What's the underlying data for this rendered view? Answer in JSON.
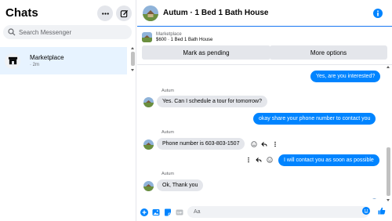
{
  "sidebar": {
    "title": "Chats",
    "more_icon": "ellipsis-icon",
    "new_message_icon": "compose-icon",
    "search_placeholder": "Search Messenger",
    "conversations": [
      {
        "name": "Marketplace",
        "time": "· 2m",
        "icon": "storefront-icon"
      }
    ]
  },
  "chat": {
    "title": "Autum · 1 Bed 1 Bath House",
    "info_icon": "info-icon",
    "listing": {
      "label": "Marketplace",
      "subtitle": "$600 · 1 Bed 1 Bath House"
    },
    "actions": {
      "pending": "Mark as pending",
      "more": "More options"
    },
    "messages": [
      {
        "direction": "out",
        "text": "Yes, are you interested?"
      },
      {
        "direction": "in",
        "sender": "Autum",
        "text": "Yes. Can I schedule a tour for tomorrow?"
      },
      {
        "direction": "out",
        "text": "okay share your phone number to contact you"
      },
      {
        "direction": "in",
        "sender": "Autum",
        "text": "Phone number is 603-803-1507"
      },
      {
        "direction": "out",
        "text": "I will contact you as soon as possible"
      },
      {
        "direction": "in",
        "sender": "Autum",
        "text": "Ok, Thank you"
      }
    ],
    "composer": {
      "placeholder": "Aa"
    }
  },
  "colors": {
    "accent": "#0084ff",
    "incoming_bubble": "#e4e6eb",
    "selected_row": "#e7f3ff"
  }
}
